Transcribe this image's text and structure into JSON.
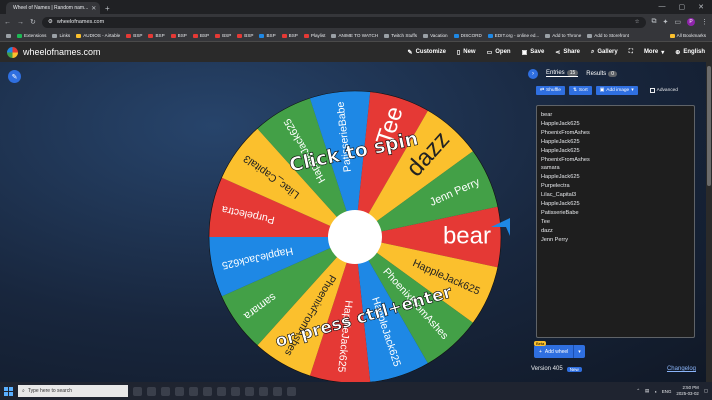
{
  "browser": {
    "tab_title": "Wheel of Names | Random nam...",
    "url": "wheelofnames.com",
    "bookmarks": [
      "Extensions",
      "Links",
      "AUDIOS - Airtable",
      "BSP",
      "BSP",
      "BSP",
      "BSP",
      "BSP",
      "BSP",
      "BSP",
      "BSP",
      "Playlist",
      "ANIME TO WATCH",
      "Twitch Stuffs",
      "Vacation",
      "DISCORD",
      "EDIT.org - online ed...",
      "Add to Throne",
      "Add to Storefront"
    ],
    "all_bookmarks": "All Bookmarks",
    "profile_initial": "P"
  },
  "app": {
    "logo_text": "wheelofnames.com",
    "menu": [
      "Customize",
      "New",
      "Open",
      "Save",
      "Share",
      "Gallery",
      "More",
      "English"
    ]
  },
  "wheel": {
    "center_text_1": "Click to spin",
    "center_text_2": "or press ctrl+enter",
    "pointer_color": "#1e88e5",
    "colors": [
      "#e53935",
      "#fbc02d",
      "#43a047",
      "#1e88e5"
    ]
  },
  "sidebar": {
    "tab_entries": "Entries",
    "entries_count": "15",
    "tab_results": "Results",
    "results_count": "0",
    "shuffle": "Shuffle",
    "sort": "Sort",
    "add_image": "Add image",
    "advanced": "Advanced",
    "entries": [
      "bear",
      "HappleJack625",
      "PhoenixFromAshes",
      "HappleJack625",
      "HappleJack625",
      "PhoenixFromAshes",
      "samara",
      "HappleJack625",
      "Purpelectra",
      "Lilac_Capital3",
      "HappleJack625",
      "PatisserieBabe",
      "Tee",
      "dazz",
      "Jenn Perry"
    ],
    "beta": "Beta",
    "add_wheel": "Add wheel",
    "version": "Version 405",
    "new_badge": "New",
    "changelog": "Changelog"
  },
  "taskbar": {
    "search_placeholder": "Type here to search",
    "lang": "ENG",
    "time": "2:50 PM",
    "date": "2025-03-02"
  }
}
